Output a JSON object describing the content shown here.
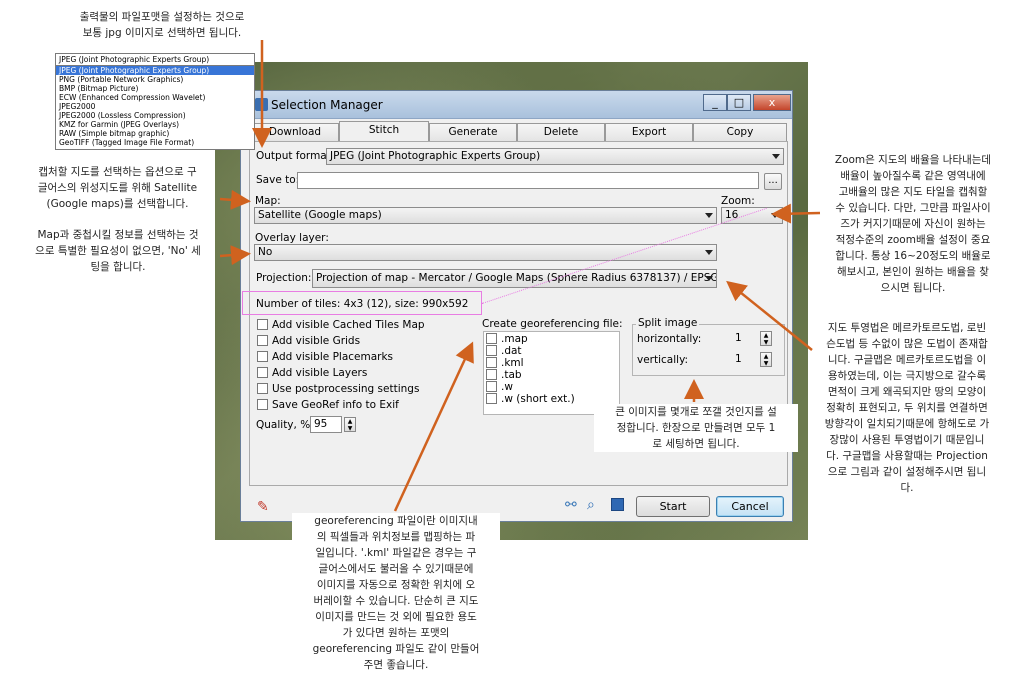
{
  "window": {
    "title": "Selection Manager",
    "controls": {
      "min": "_",
      "max": "□",
      "close": "x"
    }
  },
  "tabs": [
    {
      "label": "Download"
    },
    {
      "label": "Stitch"
    },
    {
      "label": "Generate"
    },
    {
      "label": "Delete"
    },
    {
      "label": "Export"
    },
    {
      "label": "Copy"
    }
  ],
  "form": {
    "output_format_label": "Output format:",
    "output_format_value": "JPEG (Joint Photographic Experts Group)",
    "save_to_label": "Save to:",
    "save_to_value": "",
    "browse_label": "...",
    "map_label": "Map:",
    "map_value": "Satellite (Google maps)",
    "zoom_label": "Zoom:",
    "zoom_value": "16",
    "overlay_label": "Overlay layer:",
    "overlay_value": "No",
    "projection_label": "Projection:",
    "projection_value": "Projection of map - Mercator / Google Maps (Sphere Radius 6378137) / EPSG:3785",
    "tiles_info": "Number of tiles: 4x3 (12), size: 990x592"
  },
  "options": [
    {
      "label": "Add visible Cached Tiles Map"
    },
    {
      "label": "Add visible Grids"
    },
    {
      "label": "Add visible Placemarks"
    },
    {
      "label": "Add visible Layers"
    },
    {
      "label": "Use postprocessing settings"
    },
    {
      "label": "Save GeoRef info to Exif"
    }
  ],
  "quality": {
    "label": "Quality, %",
    "value": "95"
  },
  "georef": {
    "title": "Create georeferencing file:",
    "items": [
      ".map",
      ".dat",
      ".kml",
      ".tab",
      ".w",
      ".w (short ext.)"
    ]
  },
  "split": {
    "title": "Split image",
    "horizontally_label": "horizontally:",
    "horizontally_value": "1",
    "vertically_label": "vertically:",
    "vertically_value": "1"
  },
  "buttons": {
    "start": "Start",
    "cancel": "Cancel"
  },
  "format_dropdown": {
    "selected": "JPEG (Joint Photographic Experts Group)",
    "items": [
      "JPEG (Joint Photographic Experts Group)",
      "PNG (Portable Network Graphics)",
      "BMP (Bitmap Picture)",
      "ECW (Enhanced Compression Wavelet)",
      "JPEG2000",
      "JPEG2000 (Lossless Compression)",
      "KMZ for Garmin (JPEG Overlays)",
      "RAW (Simple bitmap graphic)",
      "GeoTIFF (Tagged Image File Format)"
    ]
  },
  "annotations": {
    "format": "출력물의 파일포맷을 설정하는 것으로\n보통 jpg 이미지로 선택하면 됩니다.",
    "map": "캡처할 지도를 선택하는 옵션으로 구\n글어스의 위성지도를 위해 Satellite\n(Google maps)를 선택합니다.",
    "overlay": "Map과 중첩시킬 정보를 선택하는 것\n으로 특별한 필요성이 없으면, 'No' 세\n팅을 합니다.",
    "zoom": "Zoom은 지도의 배율을 나타내는데\n배율이 높아질수록 같은 영역내에\n고배율의 많은 지도 타일을 캡춰할\n수 있습니다. 다만, 그만큼 파일사이\n즈가 커지기때문에 자신이 원하는\n적정수준의 zoom배율 설정이 중요\n합니다. 통상 16~20정도의 배율로\n해보시고, 본인이 원하는 배율을 찾\n으시면 됩니다.",
    "projection": "지도 투영법은 메르카토르도법, 로빈\n슨도법 등 수없이 많은 도법이 존재합\n니다. 구글맵은 메르카토르도법을 이\n용하였는데, 이는 극지방으로 갈수록\n면적이 크게 왜곡되지만 땅의 모양이\n정확히 표현되고, 두 위치를 연결하면\n방향각이 일치되기때문에 항해도로 가\n장많이 사용된 투영법이기 때문입니\n다. 구글맵을 사용할때는 Projection\n으로 그림과 같이 설정해주시면 됩니\n다.",
    "split": "큰 이미지를 몇개로 쪼갤 것인지를 설\n정합니다. 한장으로 만들려면 모두 1\n로 세팅하면 됩니다.",
    "georef": "georeferencing 파일이란 이미지내\n의 픽셀들과 위치정보를 맵핑하는 파\n일입니다. '.kml' 파일같은 경우는 구\n글어스에서도 불러올 수 있기때문에\n이미지를 자동으로 정확한 위치에 오\n버레이할 수 있습니다. 단순히 큰 지도\n이미지를 만드는 것 외에 필요한 용도\n가 있다면 원하는 포맷의\ngeoreferencing 파일도 같이 만들어\n주면 좋습니다."
  },
  "colors": {
    "arrow": "#d0621f",
    "highlight": "#e87de3"
  }
}
